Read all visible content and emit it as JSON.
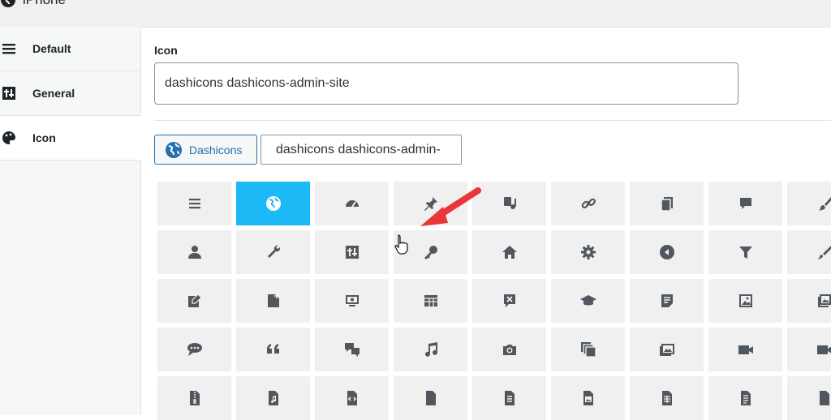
{
  "window": {
    "title": "iPhone",
    "title_icon": "globe-icon"
  },
  "sidebar": {
    "items": [
      {
        "label": "Default",
        "icon": "menu-icon",
        "active": false
      },
      {
        "label": "General",
        "icon": "sliders-icon",
        "active": false
      },
      {
        "label": "Icon",
        "icon": "palette-icon",
        "active": true
      }
    ]
  },
  "main": {
    "icon_field": {
      "label": "Icon",
      "value": "dashicons dashicons-admin-site"
    },
    "library_button": {
      "label": "Dashicons",
      "icon": "globe-icon"
    },
    "search": {
      "value": "dashicons dashicons-admin-"
    },
    "grid": {
      "selected_index": 1,
      "icons": [
        "menu-icon",
        "admin-site-icon",
        "dashboard-icon",
        "pin-icon",
        "media-icon",
        "link-icon",
        "pages-icon",
        "comment-icon",
        "brush-icon",
        "users-icon",
        "wrench-icon",
        "settings-icon",
        "key-icon",
        "home-icon",
        "gear-icon",
        "back-icon",
        "filter-icon",
        "customizer-icon",
        "edit-post-icon",
        "new-page-icon",
        "screen-icon",
        "table-icon",
        "comment-x-icon",
        "education-icon",
        "note-icon",
        "image-icon",
        "gallery-icon",
        "chat-icon",
        "quote-icon",
        "conversation-icon",
        "music-icon",
        "camera-icon",
        "images-icon",
        "slides-icon",
        "video-icon",
        "video-alt-icon",
        "archive-file-icon",
        "audio-file-icon",
        "code-file-icon",
        "file-icon",
        "text-file-icon",
        "image-file-icon",
        "spreadsheet-icon",
        "document-icon",
        "video-file-icon"
      ]
    }
  },
  "colors": {
    "accent": "#2271b1",
    "selected": "#1bb9f5",
    "icon": "#50575e",
    "arrow": "#e8363a"
  }
}
